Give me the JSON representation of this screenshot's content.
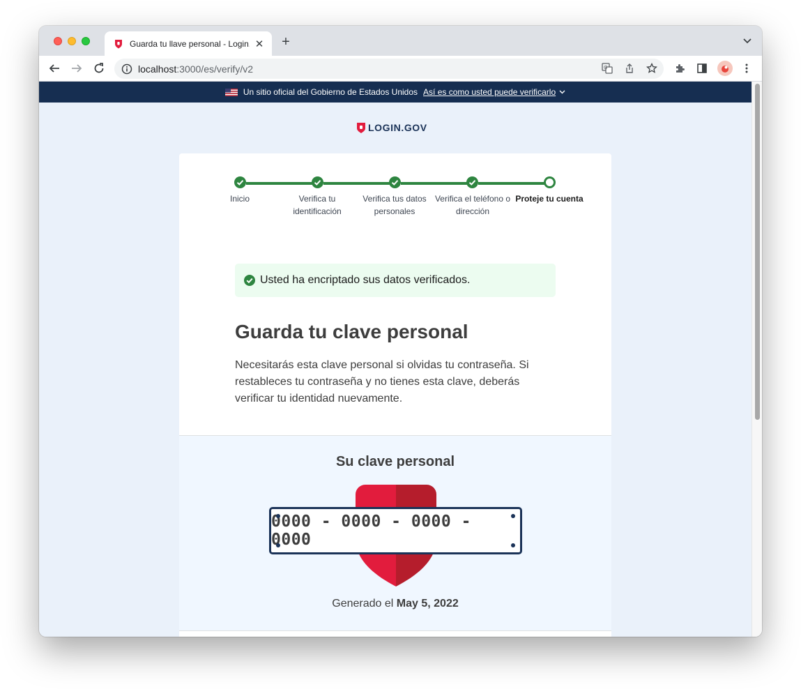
{
  "browser": {
    "tab_title": "Guarda tu llave personal - Login.gov",
    "url_host": "localhost",
    "url_path": ":3000/es/verify/v2",
    "icons": [
      "back-arrow-icon",
      "forward-arrow-icon",
      "reload-icon",
      "info-icon",
      "translate-icon",
      "share-icon",
      "star-icon",
      "extensions-icon",
      "side-panel-icon",
      "menu-icon"
    ]
  },
  "gov_banner": {
    "text": "Un sitio oficial del Gobierno de Estados Unidos",
    "link": "Así es como usted puede verificarlo"
  },
  "logo": {
    "text": "LOGIN.GOV",
    "brand_color": "#e21c3d"
  },
  "steps": [
    {
      "label": "Inicio",
      "status": "complete"
    },
    {
      "label": "Verifica tu identificación",
      "status": "complete"
    },
    {
      "label": "Verifica tus datos personales",
      "status": "complete"
    },
    {
      "label": "Verifica el teléfono o dirección",
      "status": "complete"
    },
    {
      "label": "Proteje tu cuenta",
      "status": "current"
    }
  ],
  "alert": {
    "text": "Usted ha encriptado sus datos verificados.",
    "color": "#2e8540"
  },
  "heading": "Guarda tu clave personal",
  "body": "Necesitarás esta clave personal si olvidas tu contraseña. Si restableces tu contraseña y no tienes esta clave, deberás verificar tu identidad nuevamente.",
  "personal_key": {
    "title": "Su clave personal",
    "code": "0000 - 0000 - 0000 - 0000",
    "generated_prefix": "Generado el",
    "generated_date": "May 5, 2022"
  }
}
